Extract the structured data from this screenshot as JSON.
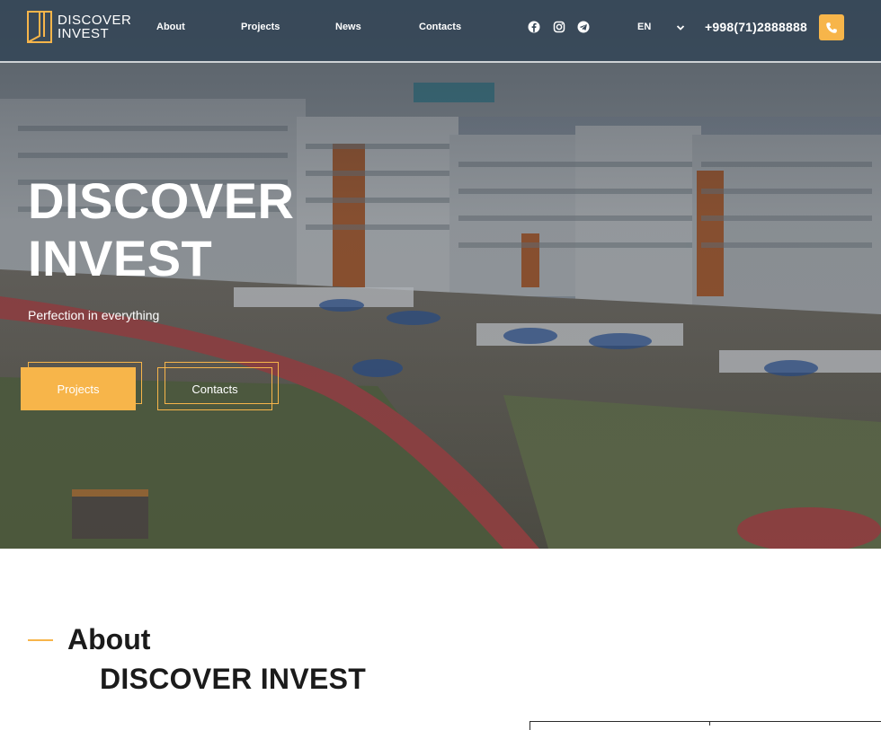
{
  "brand": {
    "line1": "DISCOVER",
    "line2": "INVEST"
  },
  "nav": [
    {
      "label": "About"
    },
    {
      "label": "Projects"
    },
    {
      "label": "News"
    },
    {
      "label": "Contacts"
    }
  ],
  "social": [
    "facebook-icon",
    "instagram-icon",
    "telegram-icon"
  ],
  "language": {
    "selected": "EN"
  },
  "phone": "+998(71)2888888",
  "hero": {
    "title_line1": "DISCOVER",
    "title_line2": "INVEST",
    "subtitle": "Perfection in everything",
    "primary_button": "Projects",
    "secondary_button": "Contacts"
  },
  "about": {
    "heading": "About",
    "subheading": "DISCOVER INVEST"
  },
  "colors": {
    "accent": "#f7b54a",
    "header_bg": "#374858",
    "text_dark": "#1b1b1b"
  }
}
